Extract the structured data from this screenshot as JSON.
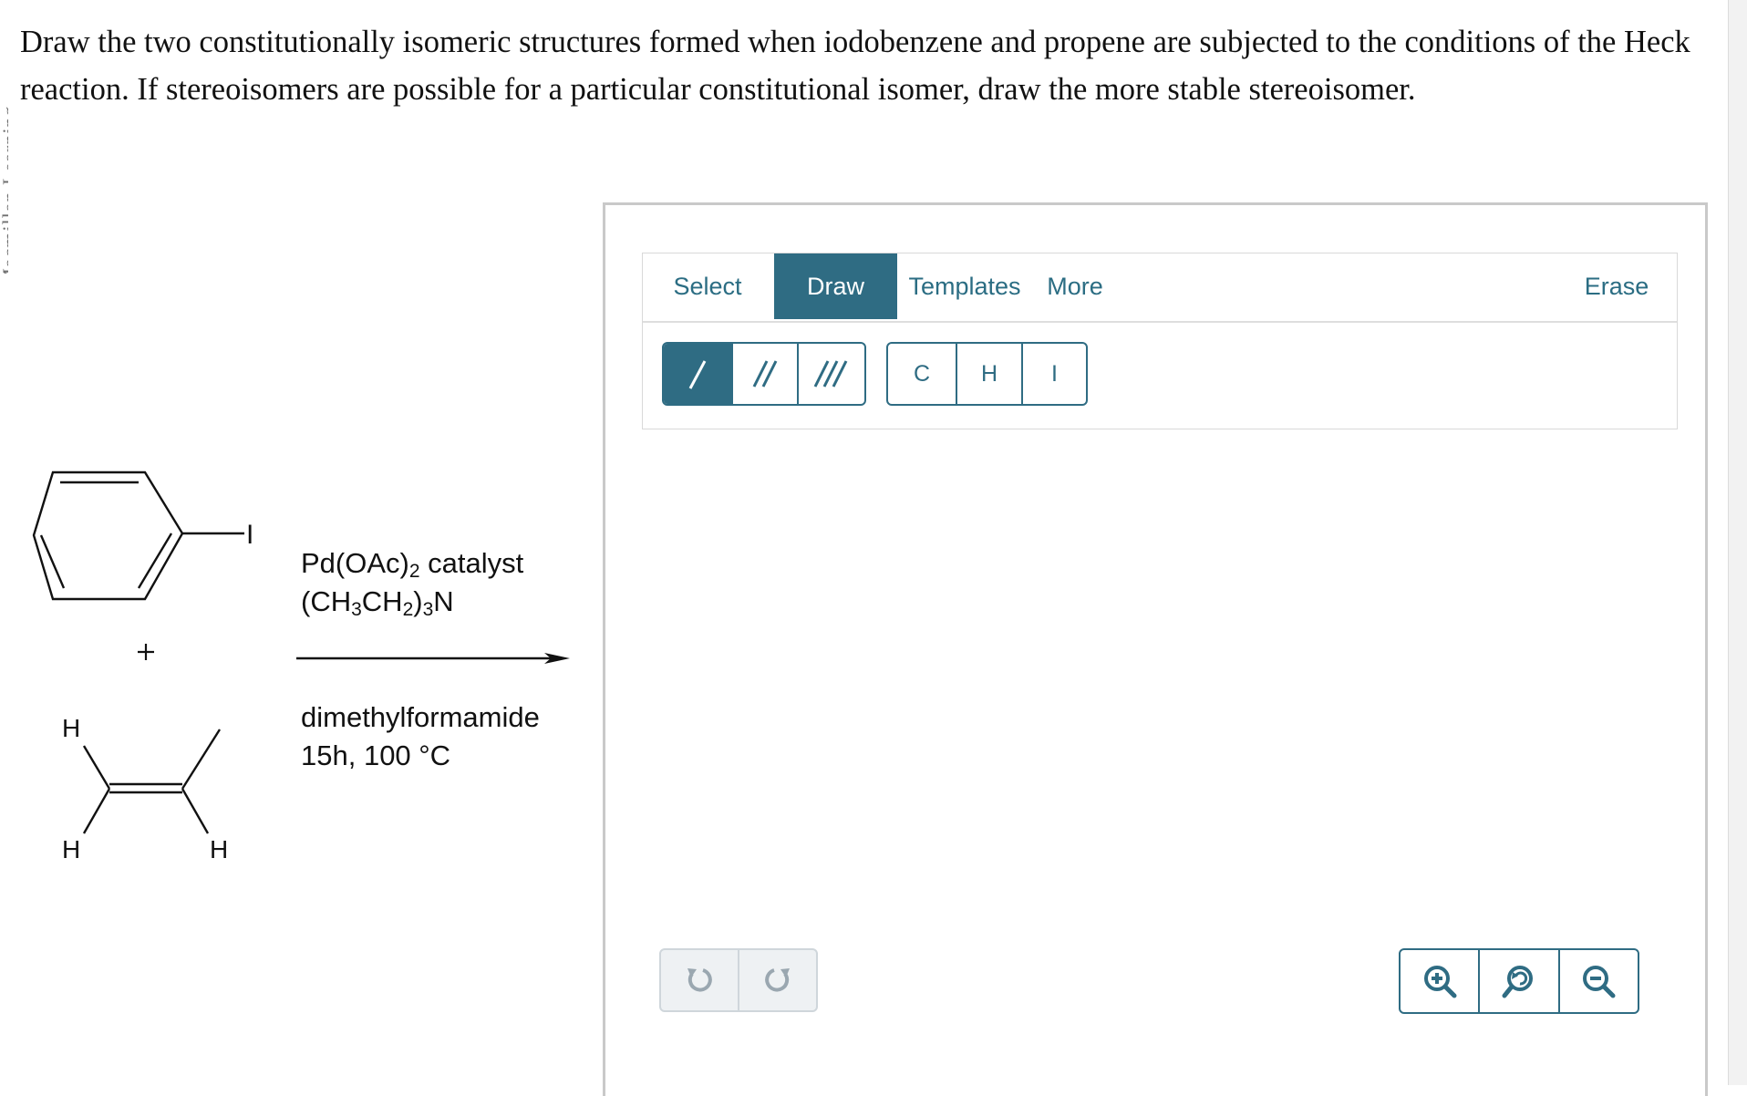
{
  "question": {
    "text": "Draw the two constitutionally isomeric structures formed when iodobenzene and propene are subjected to the conditions of the Heck reaction. If stereoisomers are possible for a particular constitutional isomer, draw the more stable stereoisomer."
  },
  "side_label": "© Macmillan Learning",
  "reaction": {
    "iodine_label": "I",
    "plus": "+",
    "h_labels": [
      "H",
      "H",
      "H"
    ],
    "conditions": {
      "line1_prefix": "Pd(OAc)",
      "line1_sub": "2",
      "line1_suffix": " catalyst",
      "line2_a": "(CH",
      "line2_sub1": "3",
      "line2_b": "CH",
      "line2_sub2": "2",
      "line2_c": ")",
      "line2_sub3": "3",
      "line2_d": "N",
      "line3": "dimethylformamide",
      "line4": "15h, 100 °C"
    }
  },
  "editor": {
    "tabs": [
      "Select",
      "Draw",
      "Templates",
      "More"
    ],
    "active_tab": "Draw",
    "erase_label": "Erase",
    "bond_tools": [
      "single-bond",
      "double-bond",
      "triple-bond"
    ],
    "active_bond": "single-bond",
    "atom_tools": [
      "C",
      "H",
      "I"
    ],
    "undo_icons": [
      "undo-icon",
      "redo-icon"
    ],
    "zoom_icons": [
      "zoom-in-icon",
      "zoom-reset-icon",
      "zoom-out-icon"
    ],
    "accent_color": "#2f6c83"
  }
}
